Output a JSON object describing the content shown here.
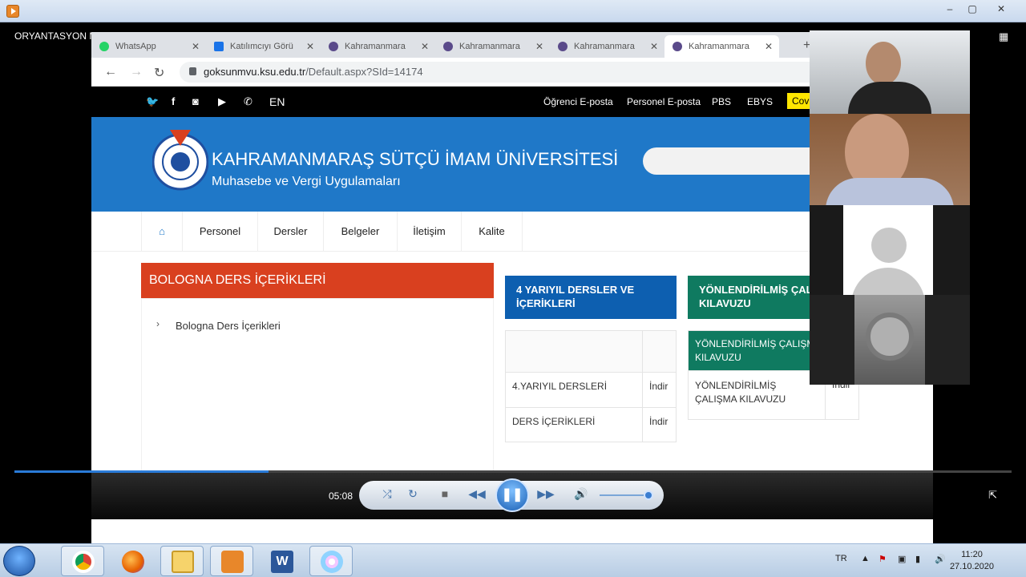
{
  "window": {
    "minimize": "–",
    "maximize": "▢",
    "close": "✕"
  },
  "player": {
    "title": "ORYANTASYON MUHASEBE",
    "time": "05:08",
    "progress_fraction": 0.255,
    "volume_fraction": 0.95
  },
  "browser": {
    "tabs": [
      {
        "label": "WhatsApp",
        "close": "✕"
      },
      {
        "label": "Katılımcıyı Görü",
        "close": "✕"
      },
      {
        "label": "Kahramanmara",
        "close": "✕"
      },
      {
        "label": "Kahramanmara",
        "close": "✕"
      },
      {
        "label": "Kahramanmara",
        "close": "✕"
      },
      {
        "label": "Kahramanmara",
        "close": "✕"
      }
    ],
    "new_tab": "+",
    "url_host": "goksunmvu.ksu.edu.tr",
    "url_path": "/Default.aspx?SId=14174"
  },
  "site": {
    "topbar": {
      "lang": "EN",
      "links": [
        "Öğrenci E-posta",
        "Personel E-posta",
        "PBS",
        "EBYS"
      ],
      "covid": "Covi"
    },
    "header": {
      "university": "KAHRAMANMARAŞ SÜTÇÜ İMAM ÜNİVERSİTESİ",
      "department": "Muhasebe ve Vergi Uygulamaları"
    },
    "menu": [
      "Personel",
      "Dersler",
      "Belgeler",
      "İletişim",
      "Kalite"
    ],
    "bologna": {
      "heading": "BOLOGNA DERS İÇERİKLERİ",
      "link": "Bologna Ders İçerikleri"
    },
    "card1": {
      "heading": "4 YARIYIL DERSLER VE İÇERİKLERİ",
      "rows": [
        {
          "name": "4.YARIYIL DERSLERİ",
          "action": "İndir"
        },
        {
          "name": "DERS İÇERİKLERİ",
          "action": "İndir"
        }
      ]
    },
    "card2": {
      "heading": "YÖNLENDİRİLMİŞ ÇALIŞMA KILAVUZU",
      "subheading": "YÖNLENDİRİLMİŞ ÇALIŞMA KILAVUZU",
      "row": {
        "name": "YÖNLENDİRİLMİŞ ÇALIŞMA KILAVUZU",
        "action": "İndir"
      }
    }
  },
  "taskbar": {
    "lang": "TR",
    "time": "11:20",
    "date": "27.10.2020"
  },
  "colors": {
    "header_blue": "#1f78c8",
    "bologna_red": "#d9401f",
    "card_blue": "#0d5fb0",
    "card_green": "#0f7a60"
  }
}
